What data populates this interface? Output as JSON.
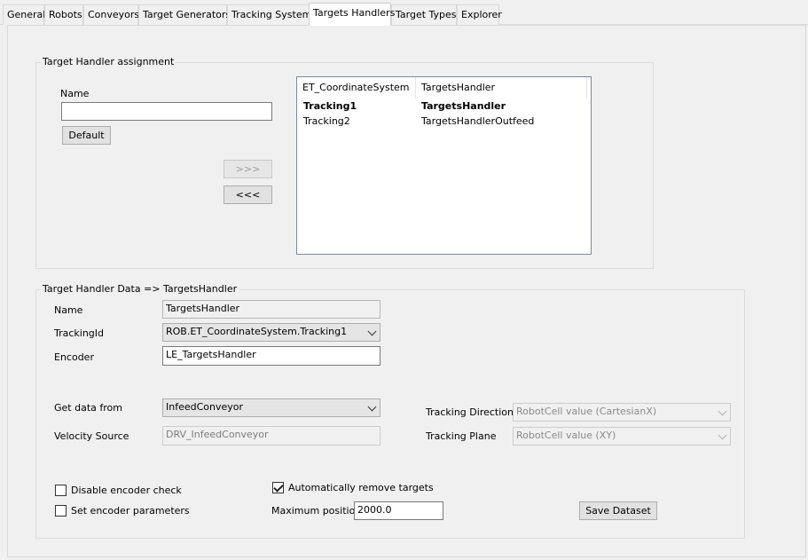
{
  "tabs": [
    {
      "label": "General"
    },
    {
      "label": "Robots"
    },
    {
      "label": "Conveyors"
    },
    {
      "label": "Target Generators"
    },
    {
      "label": "Tracking Systems"
    },
    {
      "label": "Targets Handlers",
      "active": true
    },
    {
      "label": "Target Types"
    },
    {
      "label": "Explorer"
    }
  ],
  "assignment": {
    "legend": "Target Handler assignment",
    "name_label": "Name",
    "name_value": "",
    "default_button": "Default",
    "add_button": ">>>",
    "remove_button": "<<<",
    "list": {
      "headers": [
        "ET_CoordinateSystem",
        "TargetsHandler"
      ],
      "rows": [
        {
          "system": "Tracking1",
          "handler": "TargetsHandler",
          "bold": true
        },
        {
          "system": "Tracking2",
          "handler": "TargetsHandlerOutfeed",
          "bold": false
        }
      ]
    }
  },
  "data": {
    "legend": "Target Handler Data => TargetsHandler",
    "name_label": "Name",
    "name_value": "TargetsHandler",
    "tracking_id_label": "TrackingId",
    "tracking_id_value": "ROB.ET_CoordinateSystem.Tracking1",
    "encoder_label": "Encoder",
    "encoder_value": "LE_TargetsHandler",
    "get_data_label": "Get data from",
    "get_data_value": "InfeedConveyor",
    "velocity_label": "Velocity Source",
    "velocity_value": "DRV_InfeedConveyor",
    "tracking_direction_label": "Tracking Direction",
    "tracking_direction_value": "RobotCell value (CartesianX)",
    "tracking_plane_label": "Tracking Plane",
    "tracking_plane_value": "RobotCell value (XY)",
    "disable_encoder_label": "Disable encoder check",
    "disable_encoder_checked": false,
    "set_encoder_label": "Set encoder parameters",
    "set_encoder_checked": false,
    "auto_remove_label": "Automatically remove targets",
    "auto_remove_checked": true,
    "max_position_label": "Maximum position",
    "max_position_value": "2000.0",
    "save_button": "Save Dataset"
  }
}
